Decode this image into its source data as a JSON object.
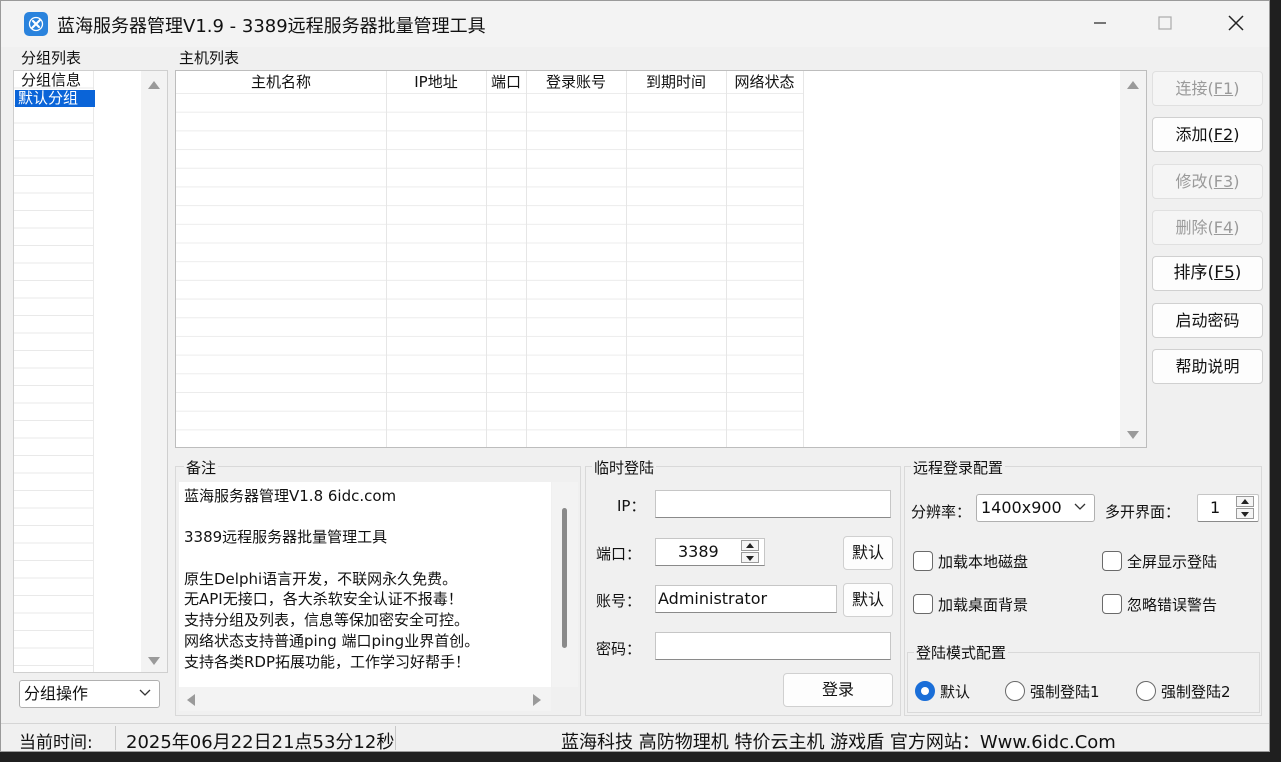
{
  "window": {
    "title": "蓝海服务器管理V1.9 - 3389远程服务器批量管理工具"
  },
  "groups": {
    "label": "分组列表",
    "items": [
      "分组信息",
      "默认分组"
    ],
    "selected_index": 1,
    "operation_select": "分组操作"
  },
  "hosts": {
    "label": "主机列表",
    "columns": [
      "主机名称",
      "IP地址",
      "端口",
      "登录账号",
      "到期时间",
      "网络状态"
    ],
    "rows": []
  },
  "side_buttons": [
    {
      "label": "连接(",
      "key": "F1",
      "suffix": ")",
      "enabled": false
    },
    {
      "label": "添加(",
      "key": "F2",
      "suffix": ")",
      "enabled": true
    },
    {
      "label": "修改(",
      "key": "F3",
      "suffix": ")",
      "enabled": false
    },
    {
      "label": "删除(",
      "key": "F4",
      "suffix": ")",
      "enabled": false
    },
    {
      "label": "排序(",
      "key": "F5",
      "suffix": ")",
      "enabled": true
    },
    {
      "label": "启动密码",
      "key": "",
      "suffix": "",
      "enabled": true
    },
    {
      "label": "帮助说明",
      "key": "",
      "suffix": "",
      "enabled": true
    }
  ],
  "notes": {
    "label": "备注",
    "lines": [
      "蓝海服务器管理V1.8  6idc.com",
      "",
      "3389远程服务器批量管理工具",
      "",
      "原生Delphi语言开发，不联网永久免费。",
      "无API无接口，各大杀软安全认证不报毒！",
      "支持分组及列表，信息等保加密安全可控。",
      "网络状态支持普通ping 端口ping业界首创。",
      "支持各类RDP拓展功能，工作学习好帮手！"
    ]
  },
  "temp_login": {
    "label": "临时登陆",
    "ip_label": "IP：",
    "ip_value": "",
    "port_label": "端口：",
    "port_value": "3389",
    "account_label": "账号：",
    "account_value": "Administrator",
    "password_label": "密码：",
    "password_value": "",
    "default_button": "默认",
    "login_button": "登录"
  },
  "remote_config": {
    "label": "远程登录配置",
    "resolution_label": "分辨率：",
    "resolution_value": "1400x900",
    "multi_label": "多开界面：",
    "multi_value": "1",
    "checkboxes": [
      {
        "label": "加载本地磁盘",
        "checked": false
      },
      {
        "label": "全屏显示登陆",
        "checked": false
      },
      {
        "label": "加载桌面背景",
        "checked": false
      },
      {
        "label": "忽略错误警告",
        "checked": false
      }
    ],
    "mode_label": "登陆模式配置",
    "modes": [
      {
        "label": "默认",
        "selected": true
      },
      {
        "label": "强制登陆1",
        "selected": false
      },
      {
        "label": "强制登陆2",
        "selected": false
      }
    ]
  },
  "statusbar": {
    "time_label": "当前时间:",
    "time_value": "2025年06月22日21点53分12秒",
    "promo": "蓝海科技 高防物理机 特价云主机 游戏盾 官方网站：Www.6idc.Com"
  },
  "colors": {
    "accent": "#1a6ed8",
    "selection": "#0a64d8",
    "icon_bg": "#2a83dd"
  }
}
